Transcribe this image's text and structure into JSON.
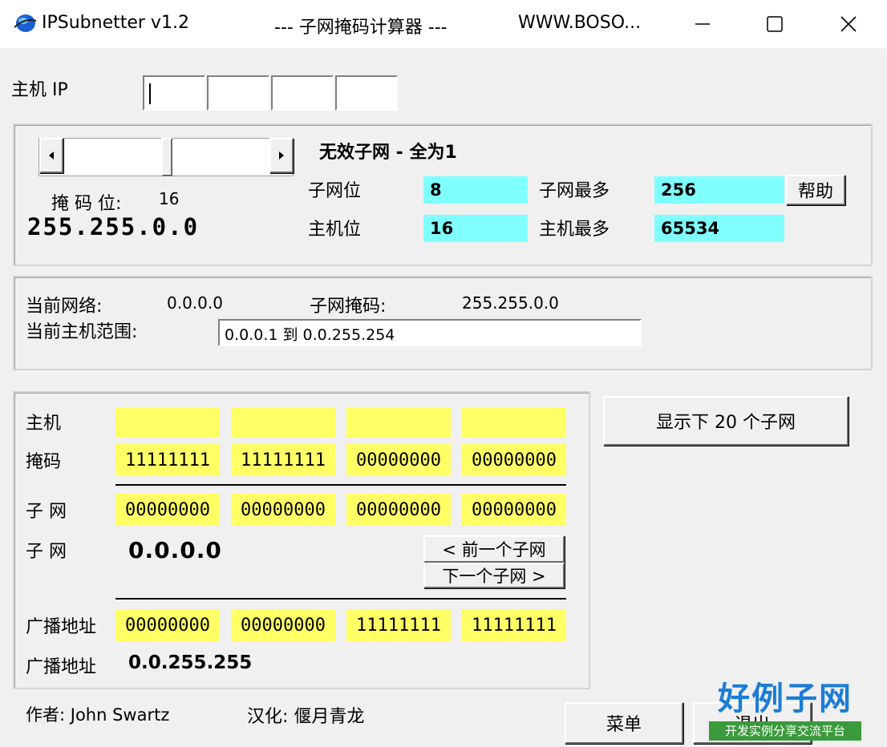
{
  "titlebar": {
    "app_name": "IPSubnetter v1.2",
    "subtitle": "--- 子网掩码计算器 ---",
    "site": "WWW.BOSO..."
  },
  "host_ip": {
    "label": "主机 IP",
    "octets": [
      "",
      "",
      "",
      ""
    ]
  },
  "mask_panel": {
    "status_text": "无效子网 - 全为1",
    "mask_bits_label": "掩 码 位:",
    "mask_bits_value": "16",
    "mask_dotted": "255.255.0.0",
    "subnet_bits_label": "子网位",
    "subnet_bits_value": "8",
    "host_bits_label": "主机位",
    "host_bits_value": "16",
    "max_subnets_label": "子网最多",
    "max_subnets_value": "256",
    "max_hosts_label": "主机最多",
    "max_hosts_value": "65534",
    "help_label": "帮助",
    "slider_position": 0.5
  },
  "network_panel": {
    "current_network_label": "当前网络:",
    "current_network_value": "0.0.0.0",
    "subnet_mask_label": "子网掩码:",
    "subnet_mask_value": "255.255.0.0",
    "host_range_label": "当前主机范围:",
    "host_range_value": "0.0.0.1  到  0.0.255.254"
  },
  "binary_panel": {
    "host_label": "主机",
    "host_bits": [
      "",
      "",
      "",
      ""
    ],
    "mask_label": "掩码",
    "mask_bits": [
      "11111111",
      "11111111",
      "00000000",
      "00000000"
    ],
    "subnet_label": "子 网",
    "subnet_bits": [
      "00000000",
      "00000000",
      "00000000",
      "00000000"
    ],
    "subnet_dotted_label": "子 网",
    "subnet_dotted": "0.0.0.0",
    "prev_subnet_label": "< 前一个子网",
    "next_subnet_label": "下一个子网 >",
    "broadcast_label": "广播地址",
    "broadcast_bits": [
      "00000000",
      "00000000",
      "11111111",
      "11111111"
    ],
    "broadcast_dotted_label": "广播地址",
    "broadcast_dotted": "0.0.255.255"
  },
  "show_next_label": "显示下 20 个子网",
  "footer": {
    "author": "作者: John Swartz",
    "translator": "汉化: 偃月青龙",
    "menu_label": "菜单",
    "exit_label": "退出"
  },
  "watermark": {
    "brand": "好例子网",
    "tagline": "开发实例分享交流平台"
  },
  "colors": {
    "cyan_field": "#80ffff",
    "yellow_field": "#ffff66",
    "window_bg": "#f0f0f0"
  }
}
